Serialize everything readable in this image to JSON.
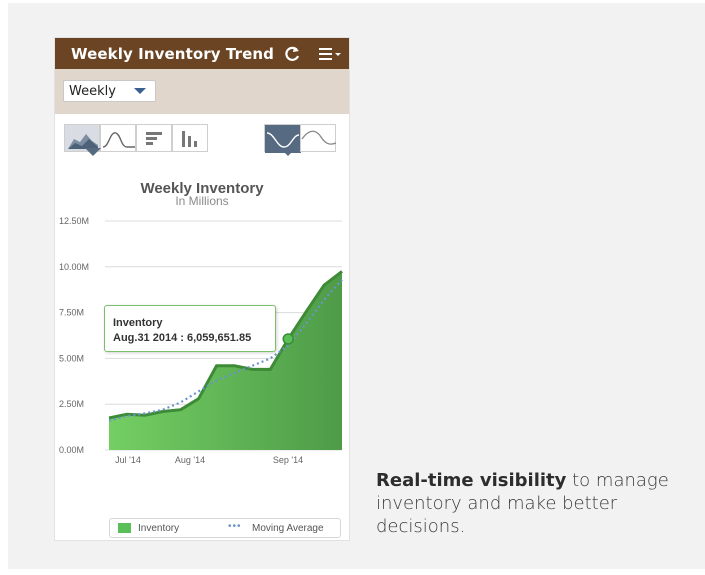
{
  "widget": {
    "title": "Weekly Inventory Trend",
    "icons": {
      "refresh": "refresh-icon",
      "menu": "menu-icon"
    },
    "filter": {
      "selected": "Weekly"
    },
    "chart_type_buttons": [
      "area-chart-icon",
      "line-chart-icon",
      "bar-chart-icon",
      "column-chart-icon"
    ],
    "trend_toggle": [
      "trend-on-icon",
      "trend-off-icon"
    ],
    "colors": {
      "header": "#6b4423",
      "filterbar": "#e0d6cc",
      "series": "#5bbf57",
      "moving_average": "#6a94c9"
    }
  },
  "chart_data": {
    "type": "area",
    "title": "Weekly Inventory",
    "subtitle": "In Millions",
    "y_ticks": [
      "12.50M",
      "10.00M",
      "7.50M",
      "5.00M",
      "2.50M",
      "0.00M"
    ],
    "x_ticks": [
      "Jul '14",
      "Aug '14",
      "Sep '14"
    ],
    "ylim": [
      0,
      12.5
    ],
    "grid": true,
    "legend_position": "bottom",
    "x": [
      "Jul.06 2014",
      "Jul.13 2014",
      "Jul.20 2014",
      "Jul.27 2014",
      "Aug.03 2014",
      "Aug.10 2014",
      "Aug.17 2014",
      "Aug.24 2014",
      "Aug.31 2014",
      "Sep.07 2014",
      "Sep.14 2014",
      "Sep.21 2014",
      "Sep.28 2014"
    ],
    "series": [
      {
        "name": "Inventory",
        "values": [
          1.75,
          1.95,
          1.9,
          2.1,
          2.2,
          2.8,
          4.6,
          4.6,
          4.4,
          4.4,
          6.06,
          7.55,
          9.0,
          9.75
        ]
      },
      {
        "name": "Moving Average",
        "values": [
          1.6,
          1.85,
          2.0,
          2.2,
          2.6,
          3.2,
          3.8,
          4.2,
          4.6,
          5.0,
          5.7,
          6.9,
          8.2,
          9.3
        ]
      }
    ],
    "tooltip": {
      "series": "Inventory",
      "text": "Aug.31 2014 : 6,059,651.85"
    },
    "legend": [
      "Inventory",
      "Moving Average"
    ]
  },
  "promo": {
    "bold": "Real-time visibility",
    "rest": " to manage inventory and make better decisions."
  }
}
